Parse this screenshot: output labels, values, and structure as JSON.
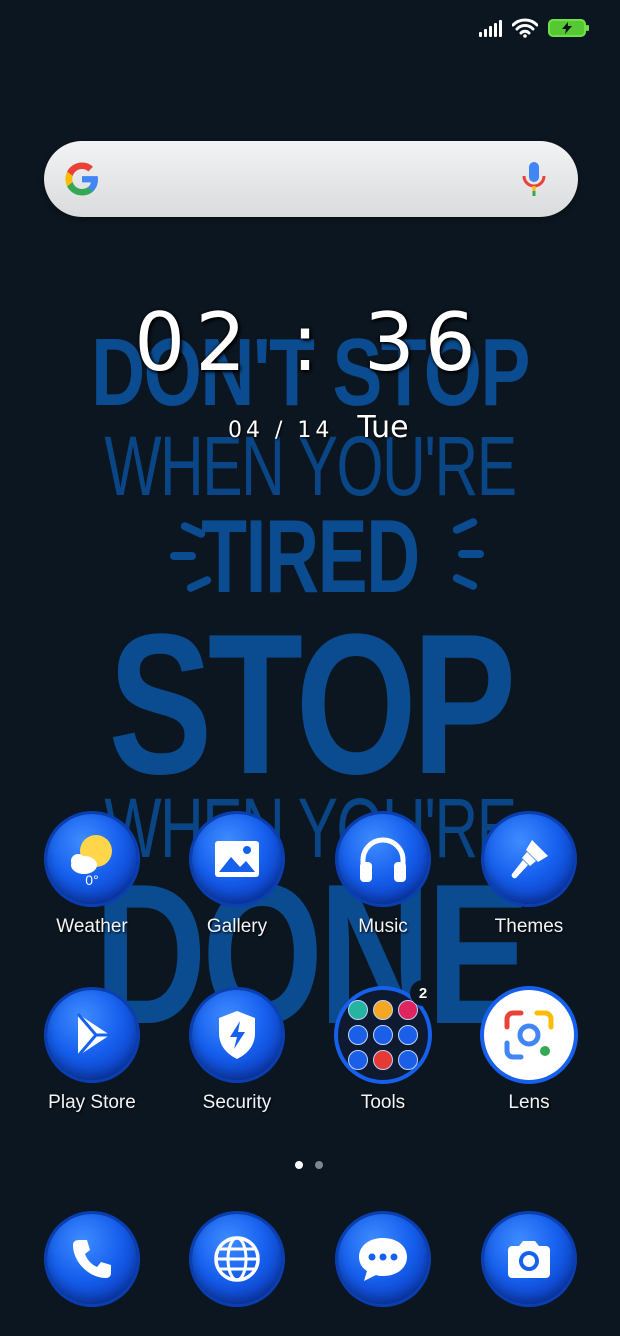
{
  "status_bar": {
    "signal_icon": "cell-signal-icon",
    "wifi_icon": "wifi-icon",
    "battery_icon": "battery-charging-icon"
  },
  "search_bar": {
    "logo": "google-g-logo",
    "mic_icon": "mic-icon"
  },
  "clock": {
    "time": "02 : 36",
    "date": "04 / 14",
    "weekday": "Tue"
  },
  "wallpaper": {
    "line1": "DON'T STOP",
    "line2": "WHEN YOU'RE",
    "line3": "TIRED",
    "line4": "STOP",
    "line5": "WHEN YOU'RE",
    "line6": "DONE"
  },
  "apps": [
    {
      "label": "Weather",
      "icon": "weather-icon",
      "temp": "0°"
    },
    {
      "label": "Gallery",
      "icon": "gallery-icon"
    },
    {
      "label": "Music",
      "icon": "headphones-icon"
    },
    {
      "label": "Themes",
      "icon": "paintbrush-icon"
    },
    {
      "label": "Play Store",
      "icon": "play-store-icon"
    },
    {
      "label": "Security",
      "icon": "shield-icon"
    },
    {
      "label": "Tools",
      "icon": "folder-icon",
      "badge": "2"
    },
    {
      "label": "Lens",
      "icon": "lens-icon"
    }
  ],
  "dock": [
    {
      "icon": "phone-icon"
    },
    {
      "icon": "browser-icon"
    },
    {
      "icon": "messages-icon"
    },
    {
      "icon": "camera-icon"
    }
  ],
  "colors": {
    "background": "#0c1620",
    "wallpaper_text": "#0b4b8f",
    "icon_blue": "#1660ee",
    "battery_green": "#55c833"
  },
  "page_indicator": {
    "pages": 2,
    "current": 1
  }
}
